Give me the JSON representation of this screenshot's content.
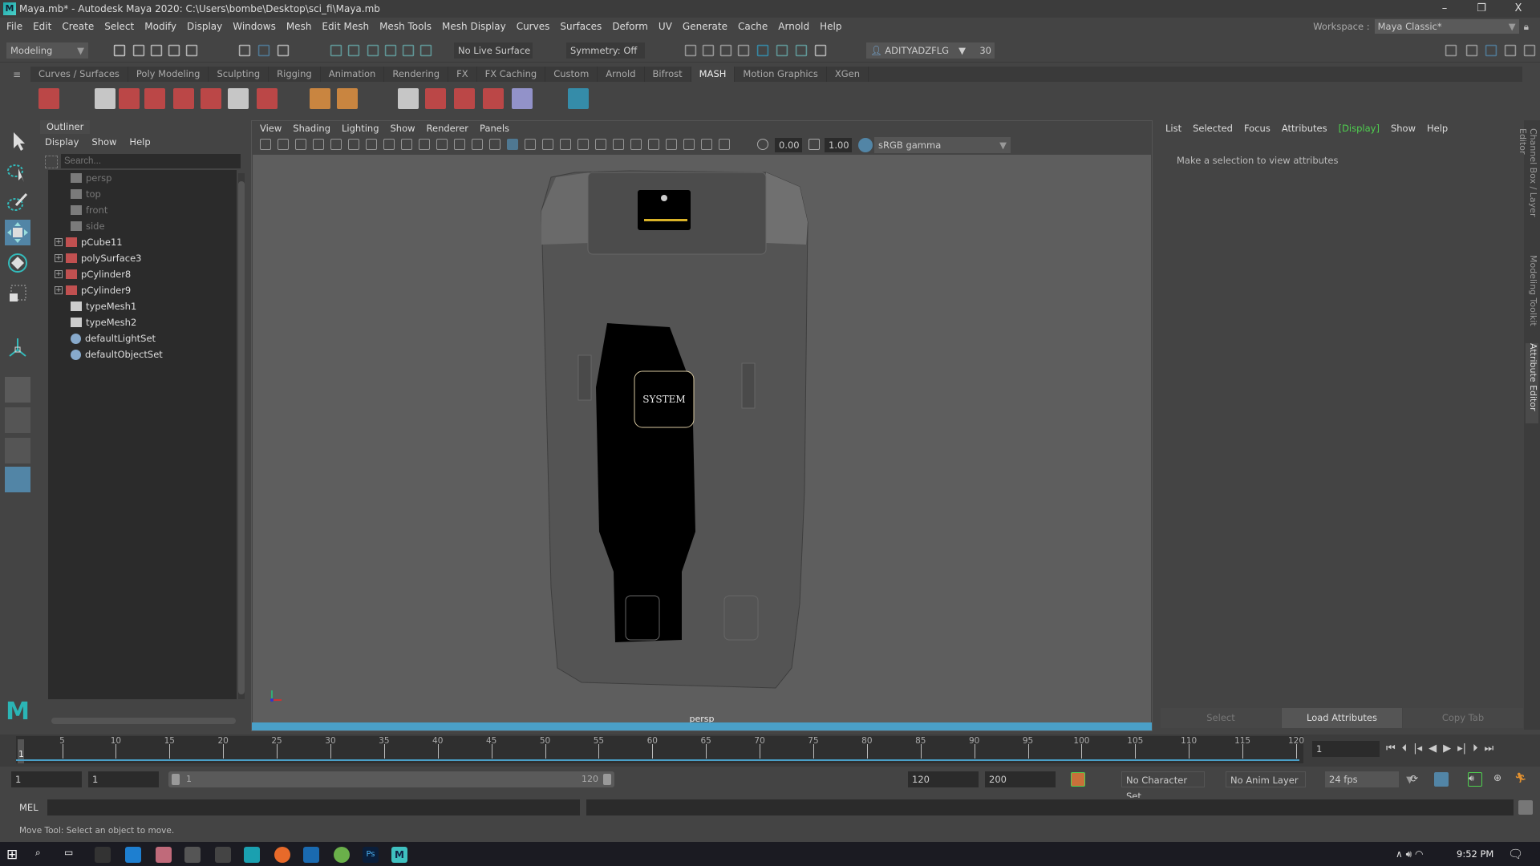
{
  "window": {
    "title": "Maya.mb* - Autodesk Maya 2020: C:\\Users\\bombe\\Desktop\\sci_fi\\Maya.mb",
    "minimize": "–",
    "maximize": "❐",
    "close": "X"
  },
  "menu": [
    "File",
    "Edit",
    "Create",
    "Select",
    "Modify",
    "Display",
    "Windows",
    "Mesh",
    "Edit Mesh",
    "Mesh Tools",
    "Mesh Display",
    "Curves",
    "Surfaces",
    "Deform",
    "UV",
    "Generate",
    "Cache",
    "Arnold",
    "Help"
  ],
  "workspace": {
    "label": "Workspace :",
    "value": "Maya Classic*"
  },
  "statusline": {
    "mode": "Modeling",
    "live_surface": "No Live Surface",
    "symmetry": "Symmetry: Off",
    "user": "ADITYADZFLG",
    "credits": "30"
  },
  "shelf": {
    "tabs": [
      "Curves / Surfaces",
      "Poly Modeling",
      "Sculpting",
      "Rigging",
      "Animation",
      "Rendering",
      "FX",
      "FX Caching",
      "Custom",
      "Arnold",
      "Bifrost",
      "MASH",
      "Motion Graphics",
      "XGen"
    ],
    "active": "MASH"
  },
  "outliner": {
    "title": "Outliner",
    "menu": [
      "Display",
      "Show",
      "Help"
    ],
    "search_placeholder": "Search...",
    "items": [
      {
        "name": "persp",
        "type": "camera",
        "dim": true,
        "expandable": false
      },
      {
        "name": "top",
        "type": "camera",
        "dim": true,
        "expandable": false
      },
      {
        "name": "front",
        "type": "camera",
        "dim": true,
        "expandable": false
      },
      {
        "name": "side",
        "type": "camera",
        "dim": true,
        "expandable": false
      },
      {
        "name": "pCube11",
        "type": "mesh",
        "dim": false,
        "expandable": true
      },
      {
        "name": "polySurface3",
        "type": "mesh",
        "dim": false,
        "expandable": true
      },
      {
        "name": "pCylinder8",
        "type": "mesh",
        "dim": false,
        "expandable": true
      },
      {
        "name": "pCylinder9",
        "type": "mesh",
        "dim": false,
        "expandable": true
      },
      {
        "name": "typeMesh1",
        "type": "type",
        "dim": false,
        "expandable": false
      },
      {
        "name": "typeMesh2",
        "type": "type",
        "dim": false,
        "expandable": false
      },
      {
        "name": "defaultLightSet",
        "type": "set",
        "dim": false,
        "expandable": false
      },
      {
        "name": "defaultObjectSet",
        "type": "set",
        "dim": false,
        "expandable": false
      }
    ]
  },
  "viewport": {
    "menu": [
      "View",
      "Shading",
      "Lighting",
      "Show",
      "Renderer",
      "Panels"
    ],
    "exposure": "0.00",
    "gamma": "1.00",
    "color_space": "sRGB gamma",
    "camera": "persp",
    "model_label": "SYSTEM"
  },
  "attribute_editor": {
    "menu": [
      "List",
      "Selected",
      "Focus",
      "Attributes"
    ],
    "display": "[Display]",
    "menu2": [
      "Show",
      "Help"
    ],
    "message": "Make a selection to view attributes",
    "buttons": {
      "select": "Select",
      "load": "Load Attributes",
      "copy": "Copy Tab"
    }
  },
  "side_tabs": [
    "Channel Box / Layer Editor",
    "Modeling Toolkit",
    "Attribute Editor"
  ],
  "timeline": {
    "start": 1,
    "end": 120,
    "labels": [
      5,
      10,
      15,
      20,
      25,
      30,
      35,
      40,
      45,
      50,
      55,
      60,
      65,
      70,
      75,
      80,
      85,
      90,
      95,
      100,
      105,
      110,
      115,
      120
    ],
    "current": "1",
    "current_frame_field": "1"
  },
  "range": {
    "start": "1",
    "playback_start": "1",
    "slider_start": "1",
    "slider_end": "120",
    "playback_end": "120",
    "end": "200",
    "character_set": "No Character Set",
    "anim_layer": "No Anim Layer",
    "fps": "24 fps"
  },
  "mel": {
    "label": "MEL"
  },
  "help_line": "Move Tool: Select an object to move.",
  "taskbar": {
    "time": "9:52 PM"
  },
  "colors": {
    "accent": "#4aa0c8",
    "active_tool": "#5285a6",
    "green": "#4fd14f"
  }
}
